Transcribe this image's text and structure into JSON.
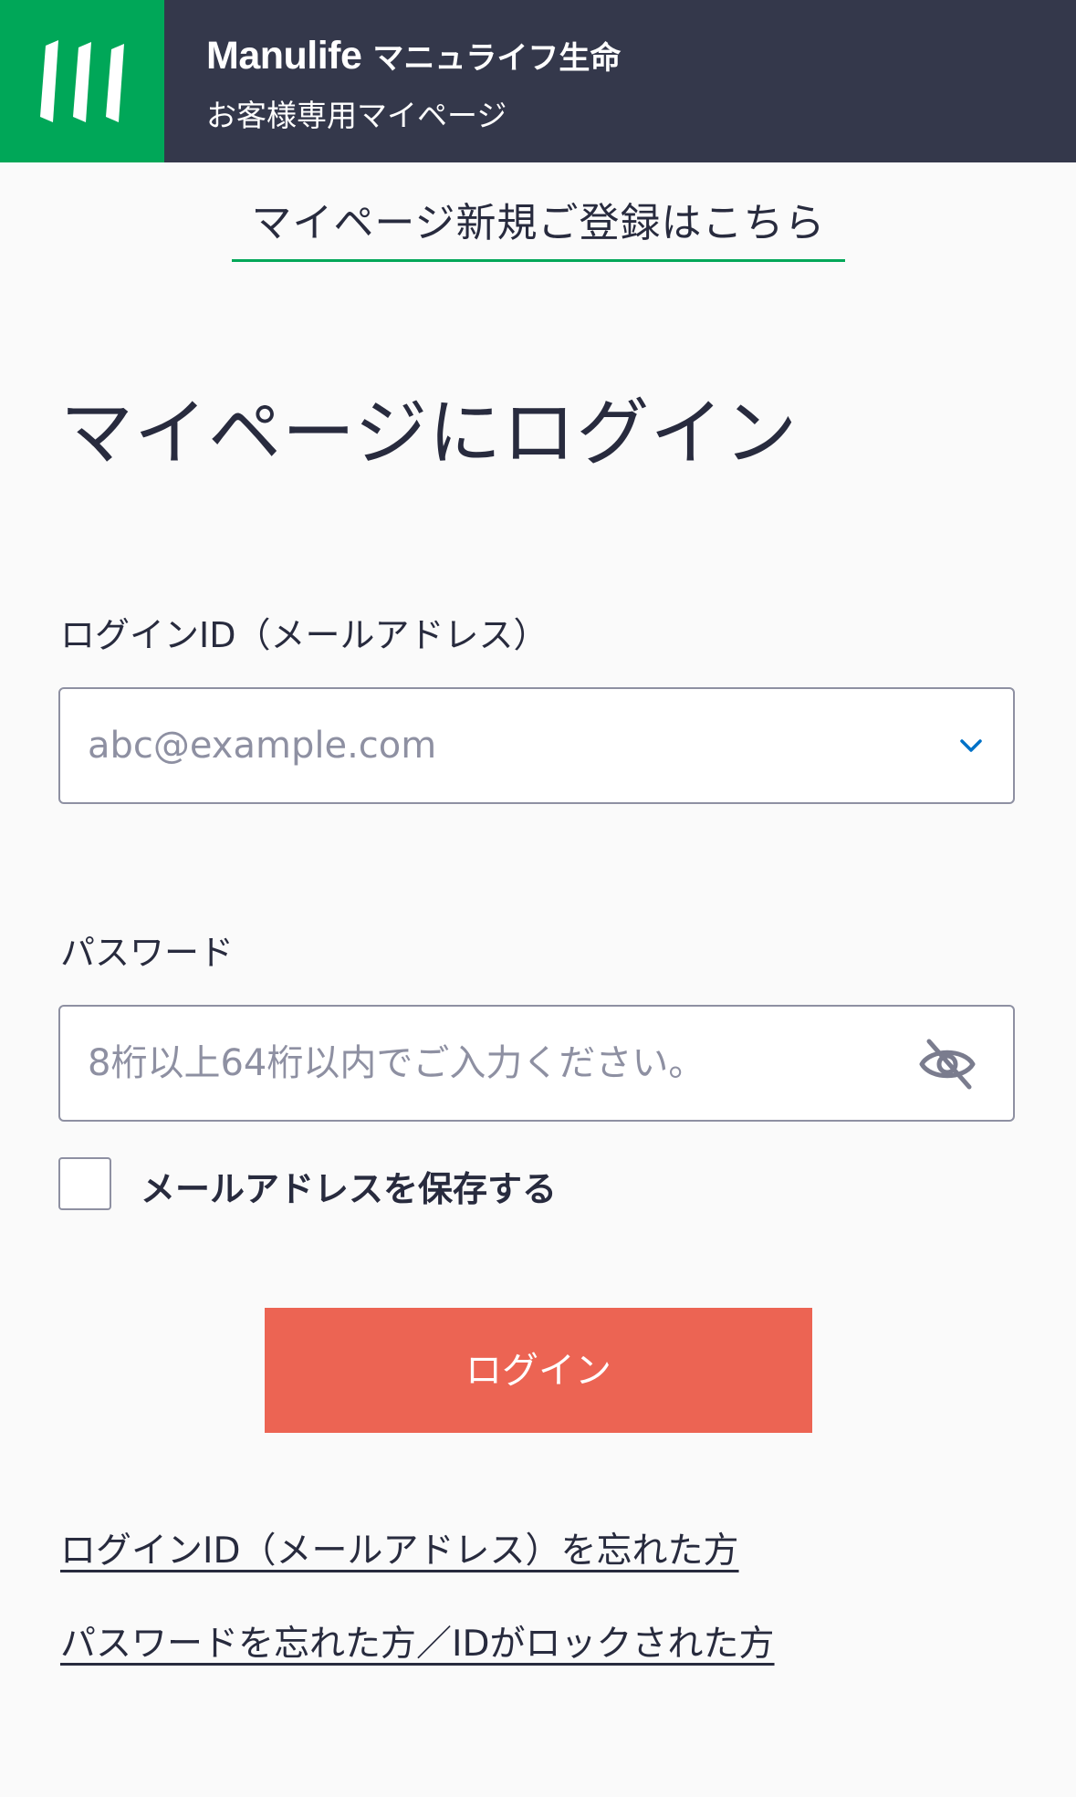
{
  "header": {
    "brand_name": "Manulife",
    "brand_jp": "マニュライフ生命",
    "subtitle": "お客様専用マイページ",
    "logo_icon": "manulife-m-logo",
    "brand_color": "#00a758",
    "bar_color": "#34384b"
  },
  "register_link": "マイページ新規ご登録はこちら",
  "page_title": "マイページにログイン",
  "login_id": {
    "label": "ログインID（メールアドレス）",
    "placeholder": "abc@example.com",
    "value": "",
    "icon": "chevron-down-icon"
  },
  "password": {
    "label": "パスワード",
    "placeholder": "8桁以上64桁以内でご入力ください。",
    "value": "",
    "icon": "eye-off-icon"
  },
  "remember": {
    "label": "メールアドレスを保存する",
    "checked": false
  },
  "login_button": {
    "label": "ログイン",
    "color": "#ec6453"
  },
  "links": {
    "forgot_id": "ログインID（メールアドレス）を忘れた方",
    "forgot_password": "パスワードを忘れた方／IDがロックされた方"
  }
}
